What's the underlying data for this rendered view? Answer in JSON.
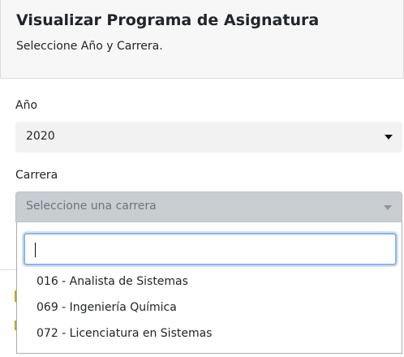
{
  "header": {
    "title": "Visualizar Programa de Asignatura",
    "subtitle": "Seleccione Año y Carrera."
  },
  "year_field": {
    "label": "Año",
    "selected": "2020"
  },
  "career_field": {
    "label": "Carrera",
    "placeholder": "Seleccione una carrera",
    "search_value": "",
    "options": [
      "016 - Analista de Sistemas",
      "069 - Ingeniería Química",
      "072 - Licenciatura en Sistemas"
    ]
  },
  "colors": {
    "header_bg": "#f7f7f7",
    "disabled_select_bg": "#c8cdd2",
    "focus_border": "#8ab4e8"
  }
}
